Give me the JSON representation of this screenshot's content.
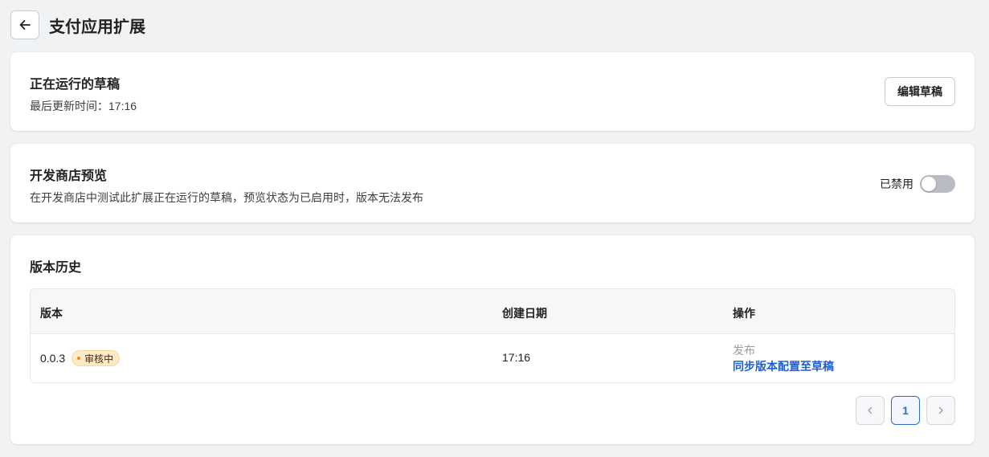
{
  "header": {
    "title": "支付应用扩展"
  },
  "draft_card": {
    "title": "正在运行的草稿",
    "updated_label": "最后更新时间：17:16",
    "edit_button": "编辑草稿"
  },
  "preview_card": {
    "title": "开发商店预览",
    "description": "在开发商店中测试此扩展正在运行的草稿，预览状态为已启用时，版本无法发布",
    "toggle_label": "已禁用",
    "toggle_on": false
  },
  "history_card": {
    "title": "版本历史",
    "columns": [
      "版本",
      "创建日期",
      "操作"
    ],
    "rows": [
      {
        "version": "0.0.3",
        "status_badge": "审核中",
        "created": "17:16",
        "action_publish": "发布",
        "action_sync": "同步版本配置至草稿"
      }
    ],
    "pagination": {
      "current_page": "1"
    }
  },
  "colors": {
    "link": "#1f5fd1",
    "badge_bg": "#ffeac7",
    "toggle_off": "#b9bcc3",
    "page_active": "#2c6ecb"
  },
  "icons": [
    "arrow-left-icon",
    "chevron-left-icon",
    "chevron-right-icon",
    "status-dot-icon"
  ]
}
